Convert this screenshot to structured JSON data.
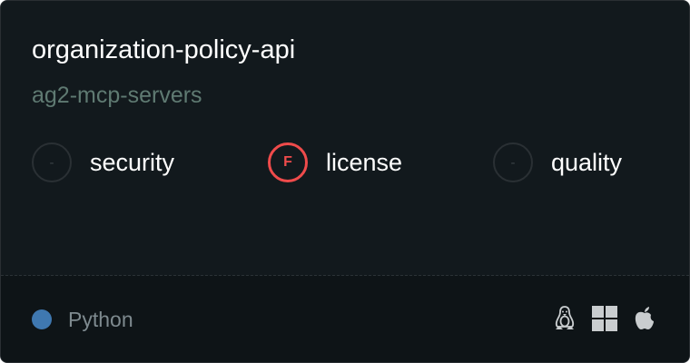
{
  "server": {
    "name": "organization-policy-api",
    "collection": "ag2-mcp-servers"
  },
  "scores": [
    {
      "grade": "-",
      "label": "security",
      "status": "unrated"
    },
    {
      "grade": "F",
      "label": "license",
      "status": "fail"
    },
    {
      "grade": "-",
      "label": "quality",
      "status": "unrated"
    }
  ],
  "language": {
    "name": "Python",
    "color": "#3f78b0"
  },
  "platforms": [
    {
      "icon": "linux-icon"
    },
    {
      "icon": "windows-icon"
    },
    {
      "icon": "apple-icon"
    }
  ],
  "colors": {
    "fail": "#ef4b4b",
    "icon": "#c9cdcf"
  }
}
